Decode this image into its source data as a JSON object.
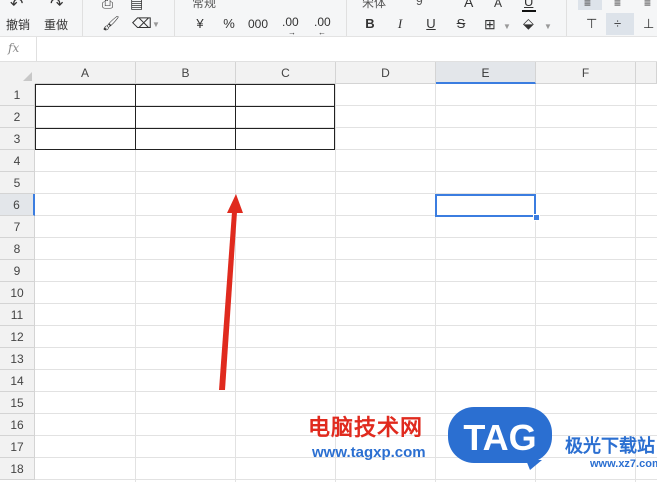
{
  "toolbar": {
    "undo_label": "撤销",
    "redo_label": "重做",
    "number_format": "常规",
    "currency_symbol": "¥",
    "percent_symbol": "%",
    "thousands_label": "000",
    "decimal_label": ".00",
    "font_name": "宋体",
    "font_size": "9",
    "bold_label": "B",
    "italic_label": "I",
    "underline_label": "U",
    "strike_label": "S",
    "font_grow_label": "A",
    "font_shrink_label": "A"
  },
  "formula_bar": {
    "fx_label": "fx",
    "value": ""
  },
  "sheet": {
    "columns": [
      "A",
      "B",
      "C",
      "D",
      "E",
      "F"
    ],
    "rows": [
      "1",
      "2",
      "3",
      "4",
      "5",
      "6",
      "7",
      "8",
      "9",
      "10",
      "11",
      "12",
      "13",
      "14",
      "15",
      "16",
      "17",
      "18"
    ],
    "selected_cell": "E6",
    "bordered_range": "A1:C3",
    "accent_color": "#3b7de0"
  },
  "watermark": {
    "cn_text": "电脑技术网",
    "url_text": "www.tagxp.com",
    "logo_text": "TAG",
    "site_cn": "极光下载站",
    "site_url": "www.xz7.com",
    "logo_color": "#2b6fd1",
    "cn_color": "#e02a1e"
  },
  "annotation": {
    "arrow_color": "#e02a1e"
  }
}
